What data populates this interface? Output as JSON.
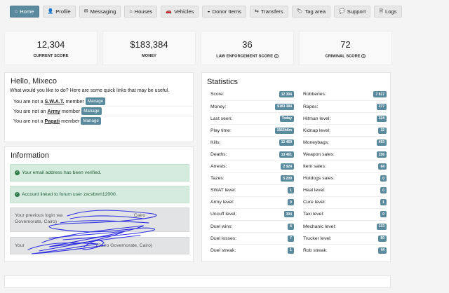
{
  "nav": [
    {
      "label": "Home",
      "icon": "home-icon",
      "glyph": "⌂",
      "active": true
    },
    {
      "label": "Profile",
      "icon": "user-icon",
      "glyph": "👤",
      "active": false
    },
    {
      "label": "Messaging",
      "icon": "envelope-icon",
      "glyph": "✉",
      "active": false
    },
    {
      "label": "Houses",
      "icon": "home-icon",
      "glyph": "⌂",
      "active": false
    },
    {
      "label": "Vehicles",
      "icon": "car-icon",
      "glyph": "🚗",
      "active": false
    },
    {
      "label": "Donor Items",
      "icon": "mask-icon",
      "glyph": "◒",
      "active": false
    },
    {
      "label": "Transfers",
      "icon": "exchange-icon",
      "glyph": "⇆",
      "active": false
    },
    {
      "label": "Tag area",
      "icon": "tag-icon",
      "glyph": "🏷",
      "active": false
    },
    {
      "label": "Support",
      "icon": "chat-icon",
      "glyph": "💬",
      "active": false
    },
    {
      "label": "Logs",
      "icon": "file-icon",
      "glyph": "🗎",
      "active": false
    }
  ],
  "summary": [
    {
      "value": "12,304",
      "label": "CURRENT SCORE",
      "help": false
    },
    {
      "value": "$183,384",
      "label": "MONEY",
      "help": false
    },
    {
      "value": "36",
      "label": "LAW ENFORCEMENT SCORE",
      "help": true
    },
    {
      "value": "72",
      "label": "CRIMINAL SCORE",
      "help": true
    }
  ],
  "hello": {
    "title": "Hello, Mixeco",
    "intro": "What would you like to do? Here are some quick links that may be useful.",
    "manage_label": "Manage",
    "members": [
      {
        "prefix": "You are not a",
        "org": "S.W.A.T.",
        "suffix": "member"
      },
      {
        "prefix": "You are not an",
        "org": "Army",
        "suffix": "member"
      },
      {
        "prefix": "You are not a",
        "org": "Pagati",
        "suffix": "member"
      }
    ]
  },
  "info": {
    "title": "Information",
    "alerts": [
      "Your email address has been verified.",
      "Account linked to forum user zxcvbnm12000."
    ],
    "login1_a": "Your previous login wa",
    "login1_b": "Cairo",
    "login1_c": "Governorate, Cairo)",
    "login2_a": "Your",
    "login2_b": "(Cairo Governorate, Cairo)"
  },
  "statistics": {
    "title": "Statistics",
    "left": [
      {
        "label": "Score:",
        "value": "12 304"
      },
      {
        "label": "Money:",
        "value": "$183 384"
      },
      {
        "label": "Last seen:",
        "value": "Today"
      },
      {
        "label": "Play time:",
        "value": "1563h6m"
      },
      {
        "label": "Kills:",
        "value": "12 469"
      },
      {
        "label": "Deaths:",
        "value": "13 461"
      },
      {
        "label": "Arrests:",
        "value": "2 924"
      },
      {
        "label": "Tazes:",
        "value": "5 209"
      },
      {
        "label": "SWAT level:",
        "value": "1"
      },
      {
        "label": "Army level:",
        "value": "0"
      },
      {
        "label": "Uncuff level:",
        "value": "304"
      },
      {
        "label": "Duel wins:",
        "value": "4"
      },
      {
        "label": "Duel losses:",
        "value": "7"
      },
      {
        "label": "Duel streak:",
        "value": "1"
      }
    ],
    "right": [
      {
        "label": "Robberies:",
        "value": "7 817"
      },
      {
        "label": "Rapes:",
        "value": "277"
      },
      {
        "label": "Hitman level:",
        "value": "324"
      },
      {
        "label": "Kidnap level:",
        "value": "32"
      },
      {
        "label": "Moneybags:",
        "value": "493"
      },
      {
        "label": "Weapon sales:",
        "value": "156"
      },
      {
        "label": "Item sales:",
        "value": "64"
      },
      {
        "label": "Hotdogs sales:",
        "value": "0"
      },
      {
        "label": "Heal level:",
        "value": "0"
      },
      {
        "label": "Cure level:",
        "value": "1"
      },
      {
        "label": "Taxi level:",
        "value": "0"
      },
      {
        "label": "Mechanic level:",
        "value": "133"
      },
      {
        "label": "Trucker level:",
        "value": "80"
      },
      {
        "label": "Rob streak:",
        "value": "44"
      }
    ]
  },
  "colors": {
    "accent": "#5a8a9e",
    "success_bg": "#d5ebdd",
    "scribble": "#1a1ae0"
  }
}
